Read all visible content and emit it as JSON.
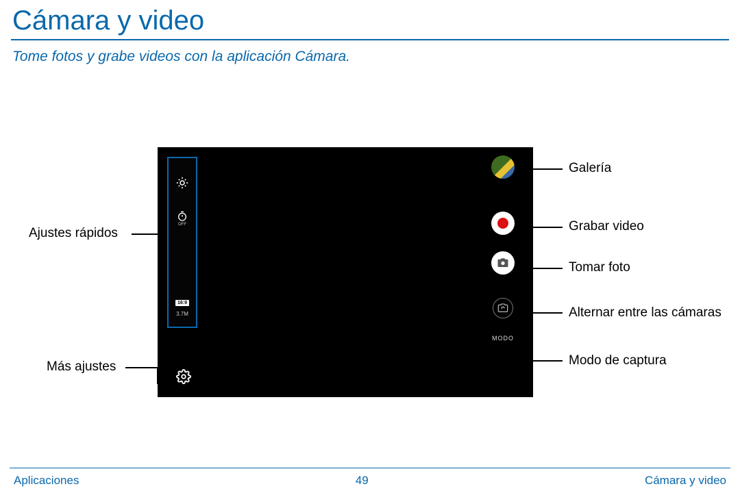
{
  "header": {
    "title": "Cámara y video",
    "subtitle": "Tome fotos y grabe videos con la aplicación Cámara."
  },
  "callouts": {
    "quick_settings": "Ajustes rápidos",
    "more_settings": "Más ajustes",
    "gallery": "Galería",
    "record": "Grabar video",
    "shutter": "Tomar foto",
    "switch": "Alternar entre las cámaras",
    "mode": "Modo de captura"
  },
  "quick_panel": {
    "aspect_ratio": "16:9",
    "megapixels": "3.7M",
    "timer_off": "OFF"
  },
  "right_controls": {
    "mode_label": "MODO"
  },
  "footer": {
    "left": "Aplicaciones",
    "page": "49",
    "right": "Cámara y video"
  }
}
